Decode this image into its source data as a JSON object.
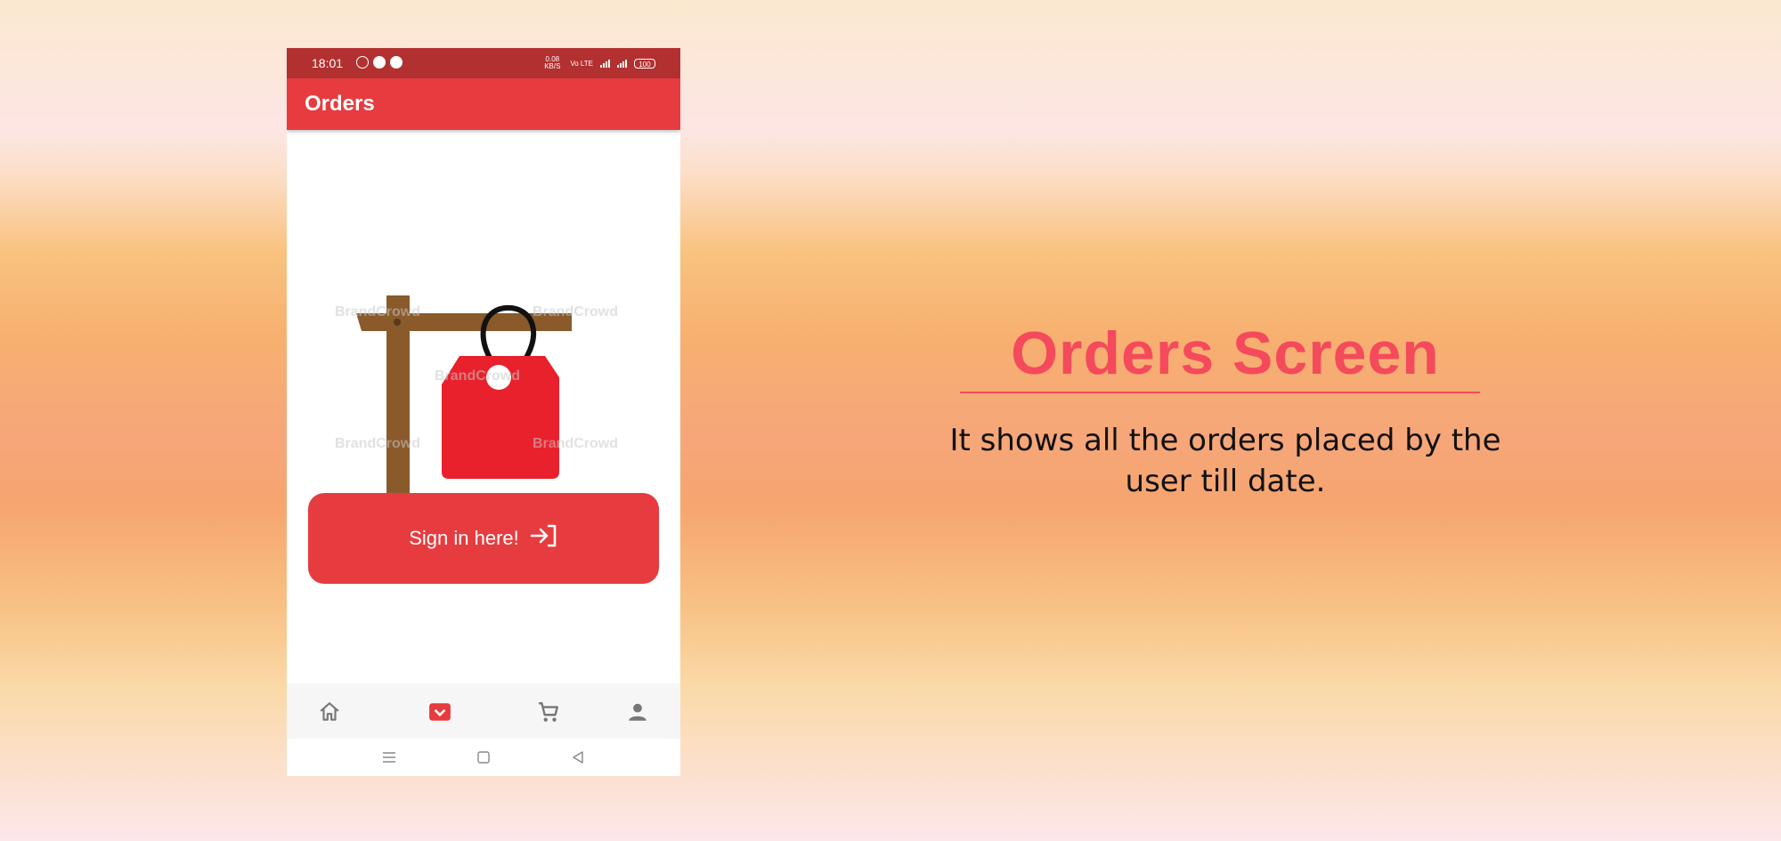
{
  "status_bar": {
    "time": "18:01",
    "notifications": [
      "whatsapp-icon",
      "message-icon",
      "notification-icon"
    ],
    "data_speed": "0.08 KB/S",
    "network": "Vo LTE",
    "battery": "100"
  },
  "app_bar": {
    "title": "Orders"
  },
  "illustration": {
    "icon": "price-tag-sign-icon",
    "watermark": "BrandCrowd"
  },
  "signin_button": {
    "label": "Sign in here!",
    "icon": "login-icon"
  },
  "bottom_nav": {
    "items": [
      {
        "icon": "home-icon",
        "active": false
      },
      {
        "icon": "orders-icon",
        "active": true
      },
      {
        "icon": "cart-icon",
        "active": false
      },
      {
        "icon": "profile-icon",
        "active": false
      }
    ]
  },
  "system_nav": [
    "menu-icon",
    "home-square-icon",
    "back-icon"
  ],
  "slide": {
    "title": "Orders Screen",
    "description": "It shows all the orders placed by the user till date."
  },
  "colors": {
    "accent": "#e63c3f",
    "status_bar": "#b33030",
    "title_pink": "#f44a5c",
    "tag_red": "#e8212c",
    "post_brown": "#8a5a2b"
  }
}
